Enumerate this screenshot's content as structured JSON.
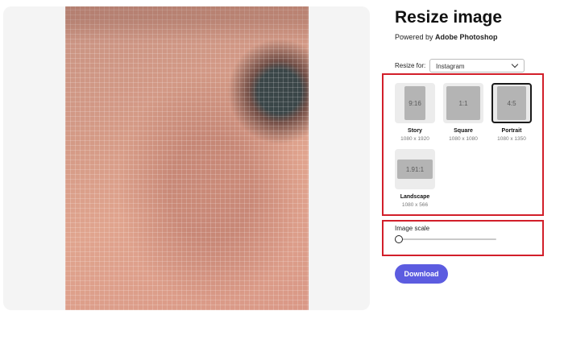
{
  "header": {
    "title": "Resize image",
    "powered_prefix": "Powered by ",
    "powered_brand": "Adobe Photoshop"
  },
  "resize_for": {
    "label": "Resize for:",
    "selected": "Instagram"
  },
  "presets": [
    {
      "name": "Story",
      "dims": "1080 x 1920",
      "ratio": "9:16",
      "selected": false
    },
    {
      "name": "Square",
      "dims": "1080 x 1080",
      "ratio": "1:1",
      "selected": false
    },
    {
      "name": "Portrait",
      "dims": "1080 x 1350",
      "ratio": "4:5",
      "selected": true
    },
    {
      "name": "Landscape",
      "dims": "1080 x 566",
      "ratio": "1.91:1",
      "selected": false
    }
  ],
  "image_scale": {
    "label": "Image scale",
    "value_fraction": 0
  },
  "download": {
    "label": "Download"
  },
  "colors": {
    "accent": "#5c5ce0",
    "highlight": "#d21f2a"
  }
}
